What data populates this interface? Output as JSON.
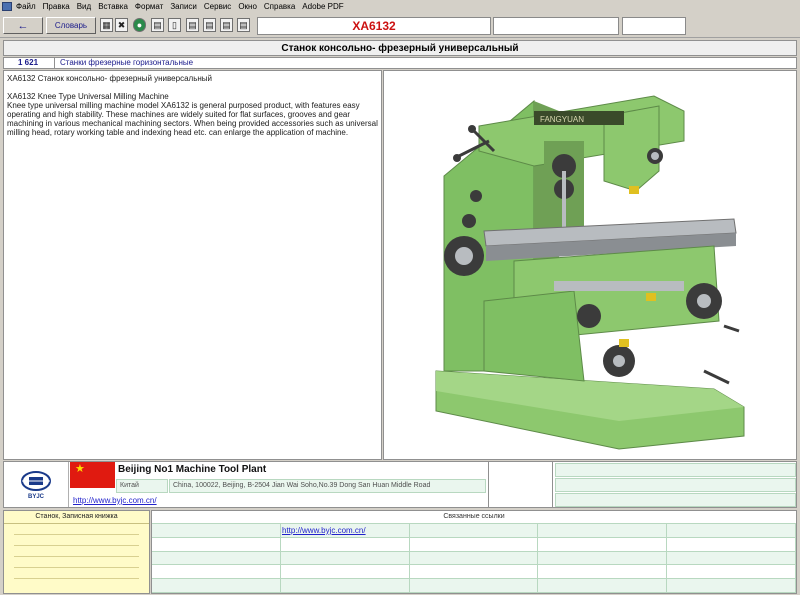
{
  "menu": {
    "items": [
      "Файл",
      "Правка",
      "Вид",
      "Вставка",
      "Формат",
      "Записи",
      "Сервис",
      "Окно",
      "Справка",
      "Adobe PDF"
    ]
  },
  "toolbar": {
    "back_label": "←",
    "dictionary_label": "Словарь",
    "icons": [
      "grid-icon",
      "tools-icon",
      "globe-icon",
      "print-icon",
      "page-icon",
      "doc-icon",
      "doc-icon",
      "doc-icon",
      "doc-icon"
    ],
    "model_code": "XA6132"
  },
  "title": "Станок консольно- фрезерный универсальный",
  "category": {
    "code": "1 621",
    "name": "Станки фрезерные горизонтальные"
  },
  "description": {
    "heading": "XA6132   Станок консольно- фрезерный универсальный",
    "body_title": "XA6132 Knee Type Universal Milling Machine",
    "body": "Knee type universal milling machine model XA6132 is general purposed product, with features easy operating and high stability. These machines are widely suited for flat surfaces, grooves and gear machining in various mechanical machining sectors. When being provided accessories such as universal milling head, rotary working table and indexing head etc. can enlarge the application of machine."
  },
  "image": {
    "alt_icon": "milling-machine-photo",
    "plate_text": "FANGYUAN",
    "colors": {
      "body": "#8dc86e",
      "shadow": "#6fa055",
      "dark": "#3b3b3b",
      "steel": "#b8bcc0"
    }
  },
  "company": {
    "logo_text": "BYJC",
    "flag": "china-flag",
    "name": "Beijing No1 Machine Tool Plant",
    "country": "Китай",
    "address": "China, 100022, Beijing, B-2504 Jian Wai Soho,No.39 Dong San Huan Middle Road",
    "url": "http://www.byjc.com.cn/"
  },
  "notes": {
    "title": "Станок, Записная книжка"
  },
  "related": {
    "title": "Связанные ссылки",
    "first_link": "http://www.byjc.com.cn/"
  },
  "colors": {
    "accent_red": "#cc1111",
    "link_blue": "#2222cc",
    "cell_green": "#eaf6ee",
    "notes_yellow": "#fffbc8"
  }
}
